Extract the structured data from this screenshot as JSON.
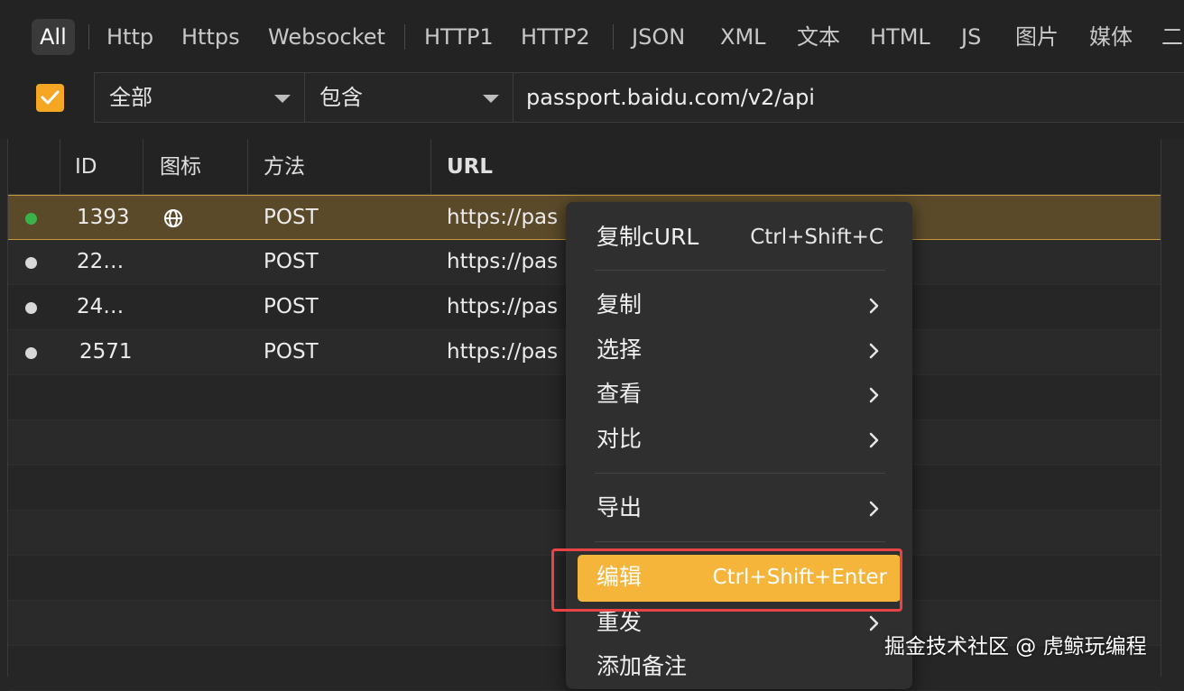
{
  "tabs": [
    {
      "label": "All"
    },
    {
      "label": "Http"
    },
    {
      "label": "Https"
    },
    {
      "label": "Websocket"
    },
    {
      "label": "HTTP1"
    },
    {
      "label": "HTTP2"
    },
    {
      "label": "JSON"
    },
    {
      "label": "XML"
    },
    {
      "label": "文本"
    },
    {
      "label": "HTML"
    },
    {
      "label": "JS"
    },
    {
      "label": "图片"
    },
    {
      "label": "媒体"
    },
    {
      "label": "二"
    }
  ],
  "filter": {
    "enabled": true,
    "scope": "全部",
    "match": "包含",
    "value": "passport.baidu.com/v2/api"
  },
  "columns": [
    "ID",
    "图标",
    "方法",
    "URL"
  ],
  "rows": [
    {
      "status": "#3bb34a",
      "id": "1393",
      "icon": "globe-icon",
      "method": "POST",
      "url": "https://pas"
    },
    {
      "status": "#d8d8d8",
      "id": "22…",
      "icon": "",
      "method": "POST",
      "url": "https://pas"
    },
    {
      "status": "#d8d8d8",
      "id": "24…",
      "icon": "",
      "method": "POST",
      "url": "https://pas"
    },
    {
      "status": "#d8d8d8",
      "id": "2571",
      "icon": "",
      "method": "POST",
      "url": "https://pas"
    }
  ],
  "context_menu": {
    "items": [
      {
        "label": "复制cURL",
        "shortcut": "Ctrl+Shift+C"
      },
      {
        "label": "复制",
        "submenu": true
      },
      {
        "label": "选择",
        "submenu": true
      },
      {
        "label": "查看",
        "submenu": true
      },
      {
        "label": "对比",
        "submenu": true
      },
      {
        "label": "导出",
        "submenu": true
      },
      {
        "label": "编辑",
        "shortcut": "Ctrl+Shift+Enter",
        "highlighted": true
      },
      {
        "label": "重发",
        "submenu": true
      },
      {
        "label": "添加备注"
      }
    ]
  },
  "colors": {
    "accent": "#f5b43a",
    "selected_row": "#5b4a2a",
    "annotation_box": "#e84446"
  },
  "watermark": "掘金技术社区 @ 虎鲸玩编程"
}
